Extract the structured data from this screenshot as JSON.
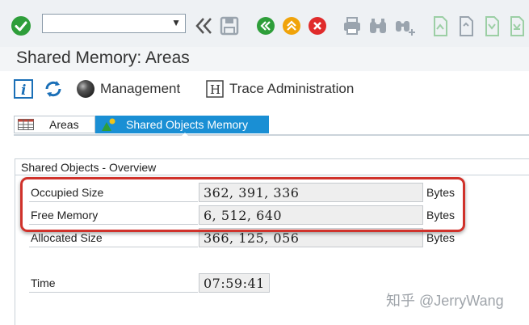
{
  "toolbar": {
    "command_field_value": "",
    "colors": {
      "ok_green": "#2e9e3a",
      "nav_green": "#2e9e3a",
      "nav_orange": "#f0a30a",
      "nav_red": "#e02b2b",
      "disabled": "#9aa4ae"
    }
  },
  "page": {
    "title": "Shared Memory: Areas"
  },
  "app_toolbar": {
    "management_label": "Management",
    "trace_label": "Trace Administration"
  },
  "tabs": [
    {
      "label": "Areas",
      "active": false
    },
    {
      "label": "Shared Objects Memory",
      "active": true
    }
  ],
  "overview": {
    "title": "Shared Objects - Overview",
    "rows": [
      {
        "label": "Occupied Size",
        "value": "362, 391, 336",
        "unit": "Bytes"
      },
      {
        "label": "Free Memory",
        "value": "6, 512, 640",
        "unit": "Bytes"
      },
      {
        "label": "Allocated Size",
        "value": "366, 125, 056",
        "unit": "Bytes"
      }
    ],
    "time_label": "Time",
    "time_value": "07:59:41"
  },
  "watermark": "知乎 @JerryWang"
}
